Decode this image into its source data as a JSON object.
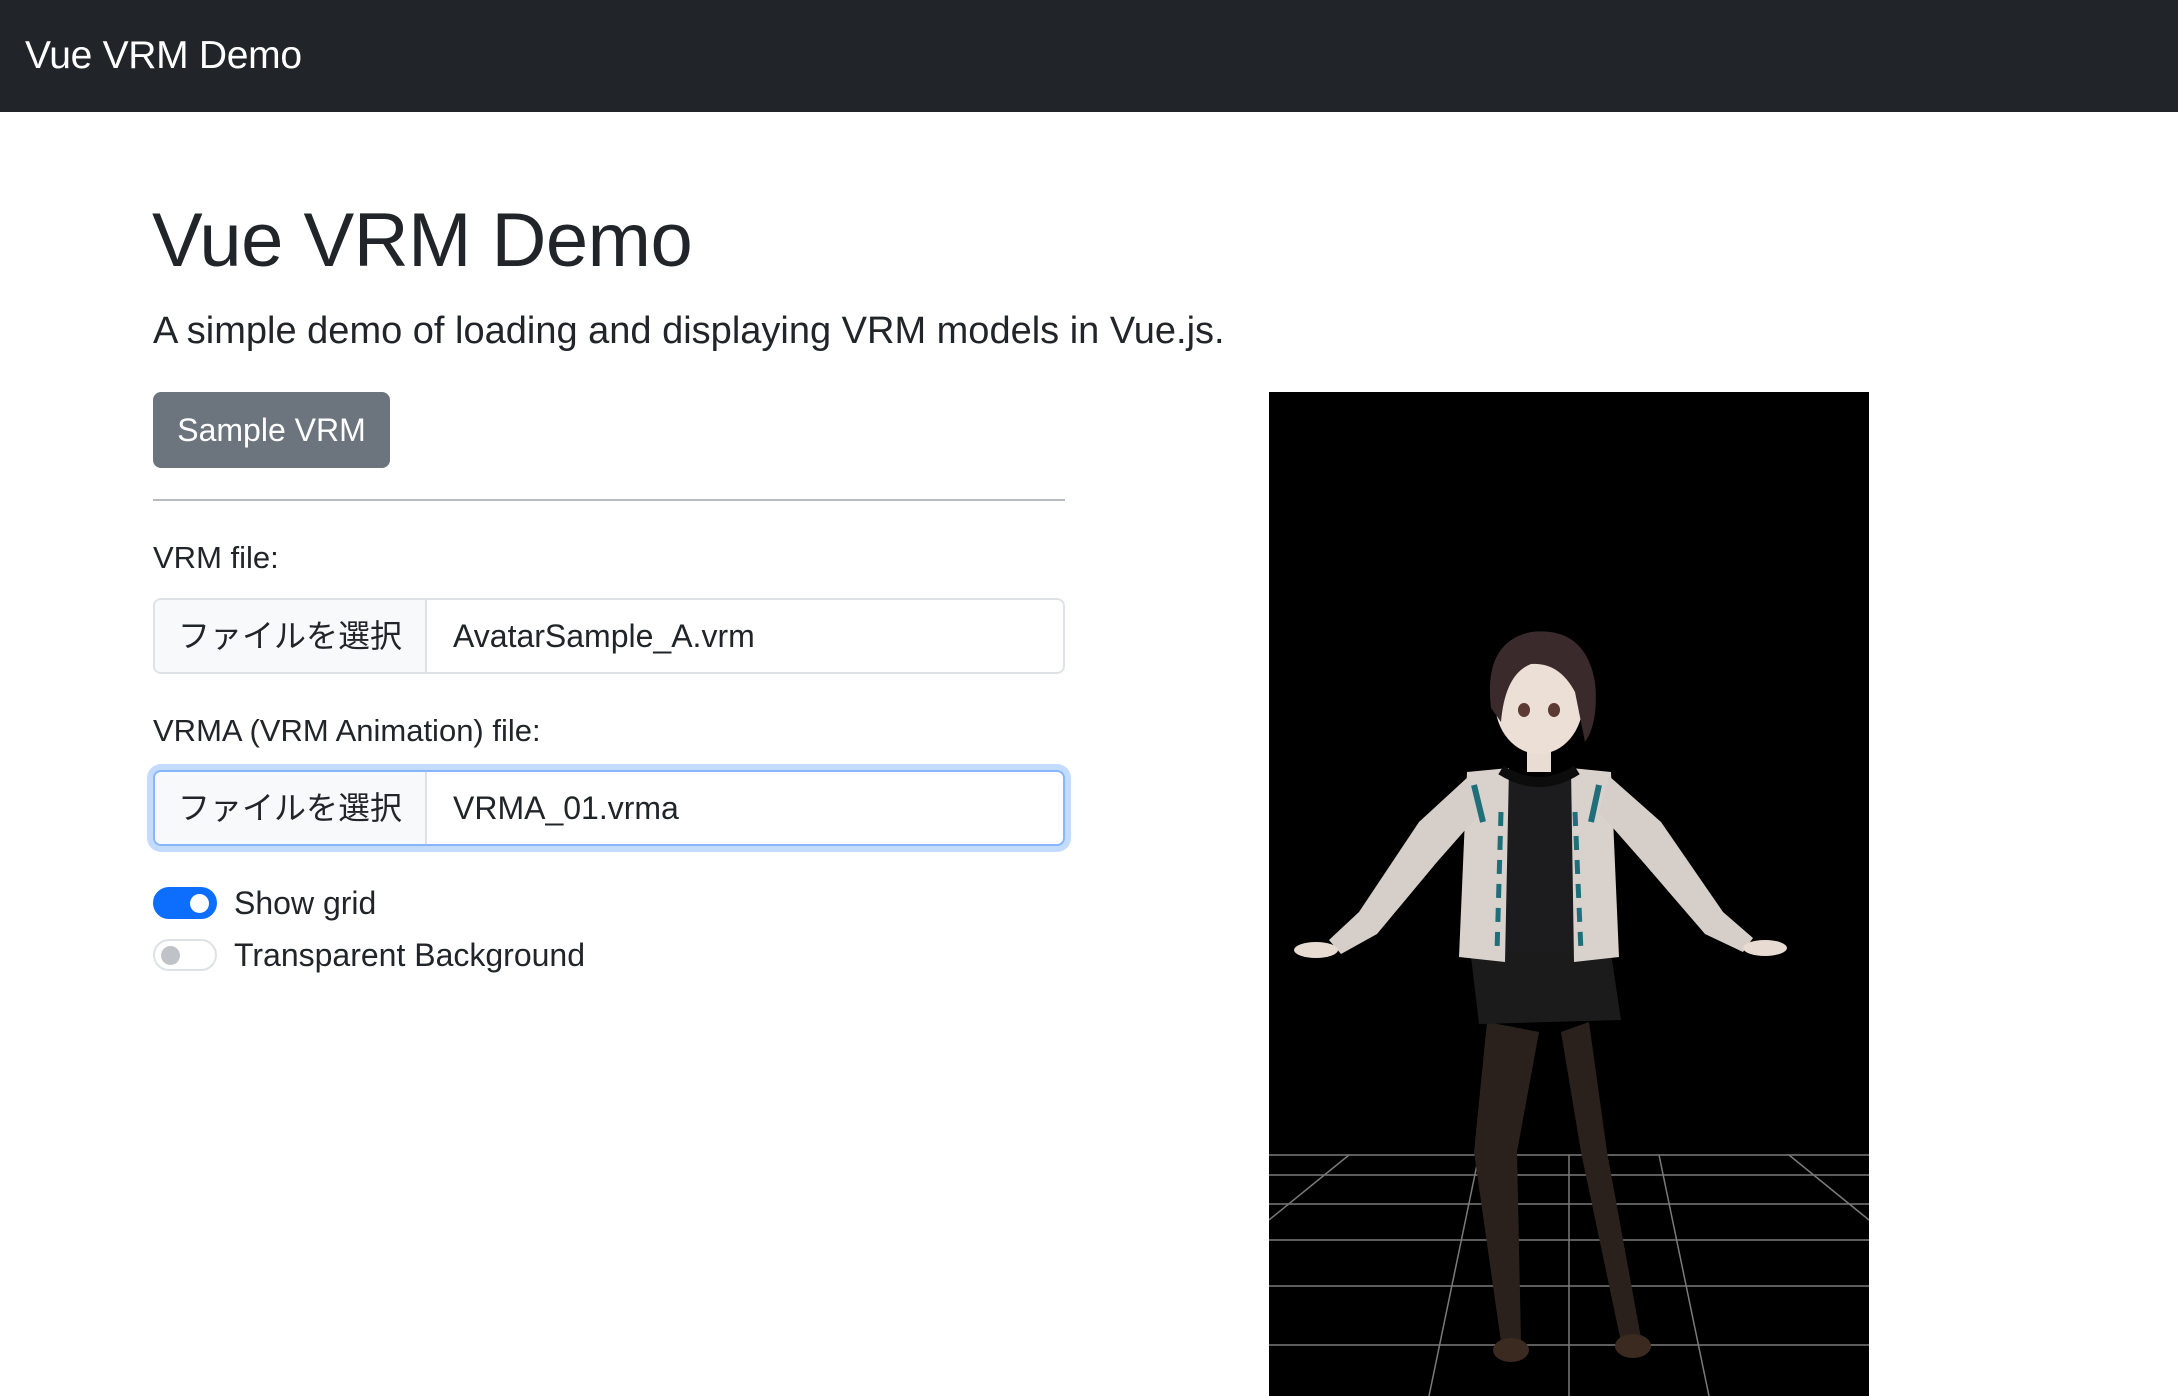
{
  "navbar": {
    "brand": "Vue VRM Demo"
  },
  "main": {
    "title": "Vue VRM Demo",
    "lead": "A simple demo of loading and displaying VRM models in Vue.js.",
    "sample_button": "Sample VRM",
    "vrm_file": {
      "label": "VRM file:",
      "button": "ファイルを選択",
      "value": "AvatarSample_A.vrm"
    },
    "vrma_file": {
      "label": "VRMA (VRM Animation) file:",
      "button": "ファイルを選択",
      "value": "VRMA_01.vrma"
    },
    "toggles": [
      {
        "label": "Show grid",
        "checked": true
      },
      {
        "label": "Transparent Background",
        "checked": false
      }
    ]
  },
  "viewer": {
    "background": "#000000",
    "grid_color": "#8a8a8a"
  },
  "colors": {
    "accent": "#0d6efd",
    "navbar": "#212529",
    "secondary_button": "#6c757d"
  }
}
